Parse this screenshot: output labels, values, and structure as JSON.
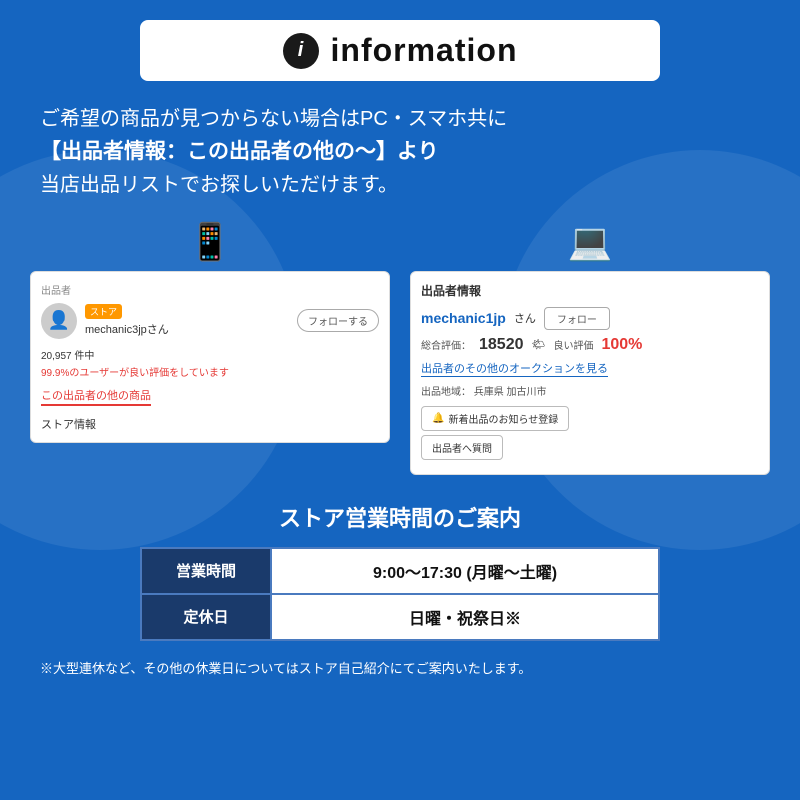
{
  "header": {
    "icon_text": "i",
    "title": "information"
  },
  "description": {
    "line1": "ご希望の商品が見つからない場合はPC・スマホ共に",
    "line2": "【出品者情報：この出品者の他の〜】より",
    "line3": "当店出品リストでお探しいただけます。"
  },
  "mobile_screenshot": {
    "section_label": "出品者",
    "store_badge": "ストア",
    "username": "mechanic3jpさん",
    "follow_btn": "フォローする",
    "stats": "20,957 件中",
    "good_rate": "99.9%のユーザーが良い評価をしています",
    "other_link": "この出品者の他の商品",
    "store_info": "ストア情報"
  },
  "pc_screenshot": {
    "section_label": "出品者情報",
    "username": "mechanic1jp",
    "username_suffix": "さん",
    "follow_btn": "フォロー",
    "rating_label": "総合評価：",
    "rating_num": "18520",
    "good_label": "良い評価",
    "good_pct": "100%",
    "auction_link": "出品者のその他のオークションを見る",
    "location_label": "出品地域：",
    "location": "兵庫県 加古川市",
    "notify_btn": "新着出品のお知らせ登録",
    "question_btn": "出品者へ質問"
  },
  "store_hours": {
    "title": "ストア営業時間のご案内",
    "rows": [
      {
        "label": "営業時間",
        "value": "9:00〜17:30 (月曜〜土曜)"
      },
      {
        "label": "定休日",
        "value": "日曜・祝祭日※"
      }
    ]
  },
  "footer_note": "※大型連休など、その他の休業日についてはストア自己紹介にてご案内いたします。"
}
